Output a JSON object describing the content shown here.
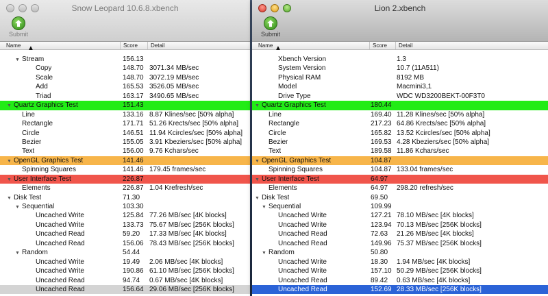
{
  "windows": [
    {
      "title": "Snow Leopard 10.6.8.xbench",
      "submit_label": "Submit",
      "columns": {
        "name": "Name",
        "score": "Score",
        "detail": "Detail"
      },
      "rows": [
        {
          "name": "Stream",
          "score": "156.13",
          "detail": "",
          "level": 1,
          "tri": "▼"
        },
        {
          "name": "Copy",
          "score": "148.70",
          "detail": "3071.34 MB/sec",
          "level": 2
        },
        {
          "name": "Scale",
          "score": "148.70",
          "detail": "3072.19 MB/sec",
          "level": 2
        },
        {
          "name": "Add",
          "score": "165.53",
          "detail": "3526.05 MB/sec",
          "level": 2
        },
        {
          "name": "Triad",
          "score": "163.17",
          "detail": "3490.65 MB/sec",
          "level": 2
        },
        {
          "name": "Quartz Graphics Test",
          "score": "151.43",
          "detail": "",
          "level": 0,
          "tri": "▼",
          "color": "green"
        },
        {
          "name": "Line",
          "score": "133.16",
          "detail": "8.87 Klines/sec [50% alpha]",
          "level": 1
        },
        {
          "name": "Rectangle",
          "score": "171.71",
          "detail": "51.26 Krects/sec [50% alpha]",
          "level": 1
        },
        {
          "name": "Circle",
          "score": "146.51",
          "detail": "11.94 Kcircles/sec [50% alpha]",
          "level": 1
        },
        {
          "name": "Bezier",
          "score": "155.05",
          "detail": "3.91 Kbeziers/sec [50% alpha]",
          "level": 1
        },
        {
          "name": "Text",
          "score": "156.00",
          "detail": "9.76 Kchars/sec",
          "level": 1
        },
        {
          "name": "OpenGL Graphics Test",
          "score": "141.46",
          "detail": "",
          "level": 0,
          "tri": "▼",
          "color": "orange"
        },
        {
          "name": "Spinning Squares",
          "score": "141.46",
          "detail": "179.45 frames/sec",
          "level": 1
        },
        {
          "name": "User Interface Test",
          "score": "226.87",
          "detail": "",
          "level": 0,
          "tri": "▼",
          "color": "red"
        },
        {
          "name": "Elements",
          "score": "226.87",
          "detail": "1.04 Krefresh/sec",
          "level": 1
        },
        {
          "name": "Disk Test",
          "score": "71.30",
          "detail": "",
          "level": 0,
          "tri": "▼"
        },
        {
          "name": "Sequential",
          "score": "103.30",
          "detail": "",
          "level": 1,
          "tri": "▼"
        },
        {
          "name": "Uncached Write",
          "score": "125.84",
          "detail": "77.26 MB/sec [4K blocks]",
          "level": 2
        },
        {
          "name": "Uncached Write",
          "score": "133.73",
          "detail": "75.67 MB/sec [256K blocks]",
          "level": 2
        },
        {
          "name": "Uncached Read",
          "score": "59.20",
          "detail": "17.33 MB/sec [4K blocks]",
          "level": 2
        },
        {
          "name": "Uncached Read",
          "score": "156.06",
          "detail": "78.43 MB/sec [256K blocks]",
          "level": 2
        },
        {
          "name": "Random",
          "score": "54.44",
          "detail": "",
          "level": 1,
          "tri": "▼"
        },
        {
          "name": "Uncached Write",
          "score": "19.49",
          "detail": "2.06 MB/sec [4K blocks]",
          "level": 2
        },
        {
          "name": "Uncached Write",
          "score": "190.86",
          "detail": "61.10 MB/sec [256K blocks]",
          "level": 2
        },
        {
          "name": "Uncached Read",
          "score": "94.74",
          "detail": "0.67 MB/sec [4K blocks]",
          "level": 2
        },
        {
          "name": "Uncached Read",
          "score": "156.64",
          "detail": "29.06 MB/sec [256K blocks]",
          "level": 2,
          "selected": "gray"
        }
      ]
    },
    {
      "title": "Lion 2.xbench",
      "submit_label": "Submit",
      "columns": {
        "name": "Name",
        "score": "Score",
        "detail": "Detail"
      },
      "rows": [
        {
          "name": "Xbench Version",
          "score": "",
          "detail": "1.3",
          "level": 2
        },
        {
          "name": "System Version",
          "score": "",
          "detail": "10.7 (11A511)",
          "level": 2
        },
        {
          "name": "Physical RAM",
          "score": "",
          "detail": "8192 MB",
          "level": 2
        },
        {
          "name": "Model",
          "score": "",
          "detail": "Macmini3,1",
          "level": 2
        },
        {
          "name": "Drive Type",
          "score": "",
          "detail": "WDC WD3200BEKT-00F3T0",
          "level": 2
        },
        {
          "name": "Quartz Graphics Test",
          "score": "180.44",
          "detail": "",
          "level": 0,
          "tri": "▼",
          "color": "green"
        },
        {
          "name": "Line",
          "score": "169.40",
          "detail": "11.28 Klines/sec [50% alpha]",
          "level": 1
        },
        {
          "name": "Rectangle",
          "score": "217.23",
          "detail": "64.86 Krects/sec [50% alpha]",
          "level": 1
        },
        {
          "name": "Circle",
          "score": "165.82",
          "detail": "13.52 Kcircles/sec [50% alpha]",
          "level": 1
        },
        {
          "name": "Bezier",
          "score": "169.53",
          "detail": "4.28 Kbeziers/sec [50% alpha]",
          "level": 1
        },
        {
          "name": "Text",
          "score": "189.58",
          "detail": "11.86 Kchars/sec",
          "level": 1
        },
        {
          "name": "OpenGL Graphics Test",
          "score": "104.87",
          "detail": "",
          "level": 0,
          "tri": "▼",
          "color": "orange"
        },
        {
          "name": "Spinning Squares",
          "score": "104.87",
          "detail": "133.04 frames/sec",
          "level": 1
        },
        {
          "name": "User Interface Test",
          "score": "64.97",
          "detail": "",
          "level": 0,
          "tri": "▼",
          "color": "red"
        },
        {
          "name": "Elements",
          "score": "64.97",
          "detail": "298.20 refresh/sec",
          "level": 1
        },
        {
          "name": "Disk Test",
          "score": "69.50",
          "detail": "",
          "level": 0,
          "tri": "▼"
        },
        {
          "name": "Sequential",
          "score": "109.99",
          "detail": "",
          "level": 1,
          "tri": "▼"
        },
        {
          "name": "Uncached Write",
          "score": "127.21",
          "detail": "78.10 MB/sec [4K blocks]",
          "level": 2
        },
        {
          "name": "Uncached Write",
          "score": "123.94",
          "detail": "70.13 MB/sec [256K blocks]",
          "level": 2
        },
        {
          "name": "Uncached Read",
          "score": "72.63",
          "detail": "21.26 MB/sec [4K blocks]",
          "level": 2
        },
        {
          "name": "Uncached Read",
          "score": "149.96",
          "detail": "75.37 MB/sec [256K blocks]",
          "level": 2
        },
        {
          "name": "Random",
          "score": "50.80",
          "detail": "",
          "level": 1,
          "tri": "▼"
        },
        {
          "name": "Uncached Write",
          "score": "18.30",
          "detail": "1.94 MB/sec [4K blocks]",
          "level": 2
        },
        {
          "name": "Uncached Write",
          "score": "157.10",
          "detail": "50.29 MB/sec [256K blocks]",
          "level": 2
        },
        {
          "name": "Uncached Read",
          "score": "89.42",
          "detail": "0.63 MB/sec [4K blocks]",
          "level": 2
        },
        {
          "name": "Uncached Read",
          "score": "152.69",
          "detail": "28.33 MB/sec [256K blocks]",
          "level": 2,
          "selected": "blue"
        }
      ]
    }
  ],
  "colors": {
    "green": "#22ec16",
    "orange": "#f7b54a",
    "red": "#f0554b",
    "selection_blue": "#2b63d7",
    "selection_gray": "#d4d4d4"
  }
}
